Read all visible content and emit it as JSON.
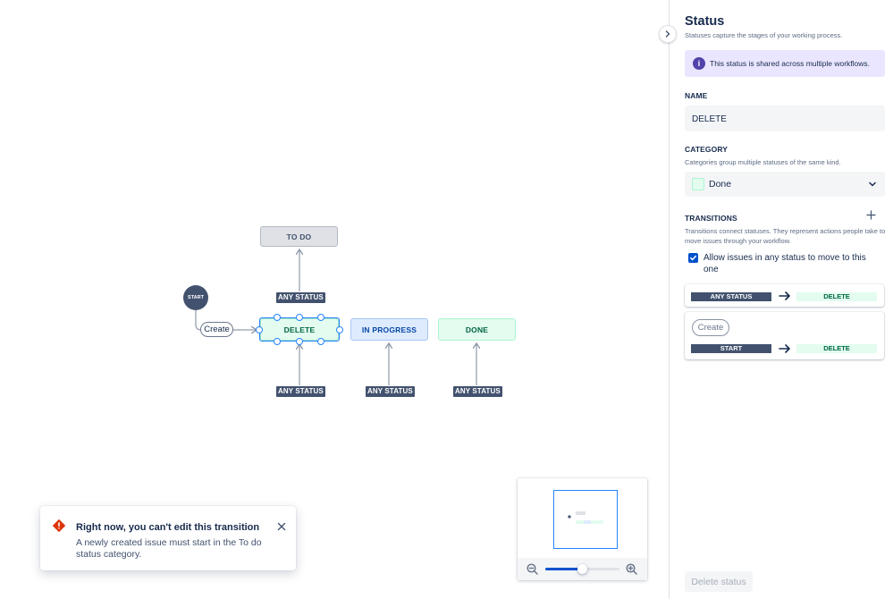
{
  "workflow": {
    "statuses": {
      "todo": "TO DO",
      "delete": "DELETE",
      "in_progress": "IN PROGRESS",
      "done": "DONE"
    },
    "any_status_label": "ANY STATUS",
    "start_label": "START",
    "create_transition_label": "Create"
  },
  "toast": {
    "title": "Right now, you can't edit this transition",
    "body": "A newly created issue must start in the To do status category.",
    "icon": "error-icon"
  },
  "minimap": {
    "zoom_level": 0.5
  },
  "panel": {
    "title": "Status",
    "subtitle": "Statuses capture the stages of your working process.",
    "info_message": "This status is shared across multiple workflows.",
    "name_label": "NAME",
    "name_value": "DELETE",
    "category_label": "CATEGORY",
    "category_description": "Categories group multiple statuses of the same kind.",
    "category_value": "Done",
    "transitions_label": "TRANSITIONS",
    "transitions_description": "Transitions connect statuses. They represent actions people take to move issues through your workflow.",
    "allow_any_label": "Allow issues in any status to move to this one",
    "allow_any_checked": true,
    "transitions": [
      {
        "from": "ANY STATUS",
        "to": "DELETE"
      },
      {
        "name": "Create",
        "from": "START",
        "to": "DELETE"
      }
    ],
    "delete_button": "Delete status"
  },
  "colors": {
    "accent": "#0052cc",
    "selection": "#2684ff",
    "done_green": "#e3fcef",
    "in_progress_blue": "#deebff",
    "todo_grey": "#dfe1e6",
    "dark_tag": "#42526e",
    "error": "#de350b",
    "info_purple": "#5243aa"
  }
}
